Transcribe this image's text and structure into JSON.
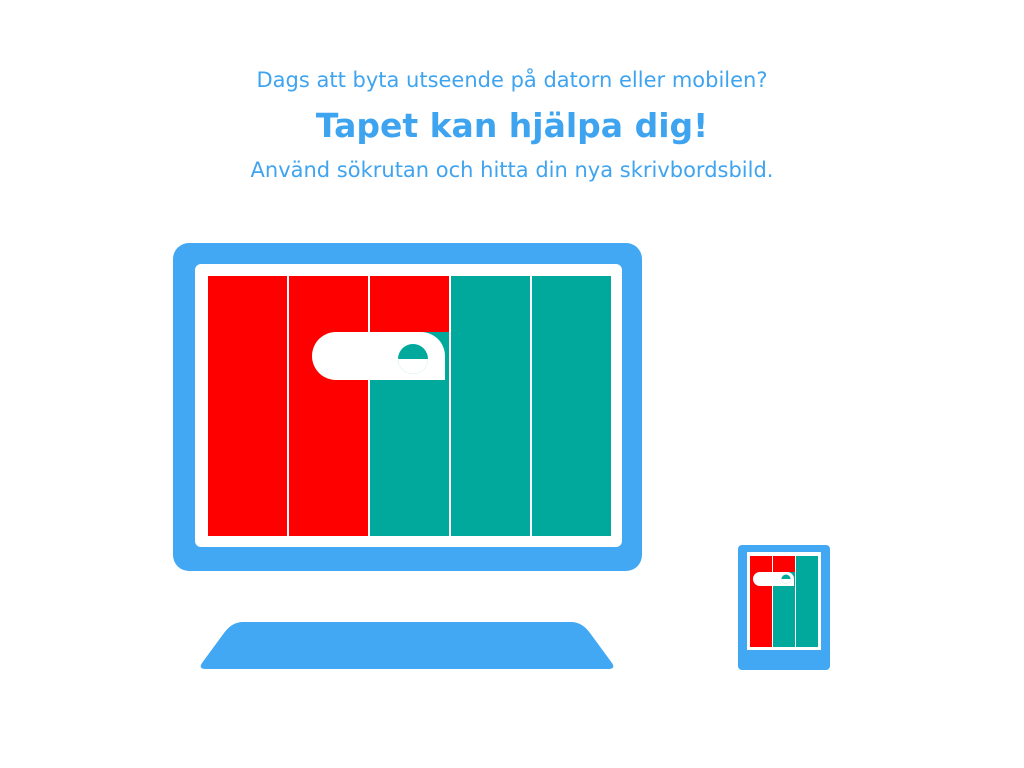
{
  "hero": {
    "intro": "Dags att byta utseende på datorn eller mobilen?",
    "headline": "Tapet kan hjälpa dig!",
    "subline": "Använd sökrutan och hitta din nya skrivbordsbild."
  },
  "illustration": {
    "desktop": {
      "icon": "desktop-monitor-icon"
    },
    "keyboard": {
      "icon": "keyboard-icon"
    },
    "phone": {
      "icon": "mobile-phone-icon"
    },
    "wallpaper_roll": {
      "icon": "wallpaper-roll-icon"
    }
  },
  "colors": {
    "text": "#3fa4f0",
    "device": "#42a8f4",
    "stripe_red": "#ff0000",
    "stripe_teal": "#00a99c",
    "background": "#ffffff"
  }
}
